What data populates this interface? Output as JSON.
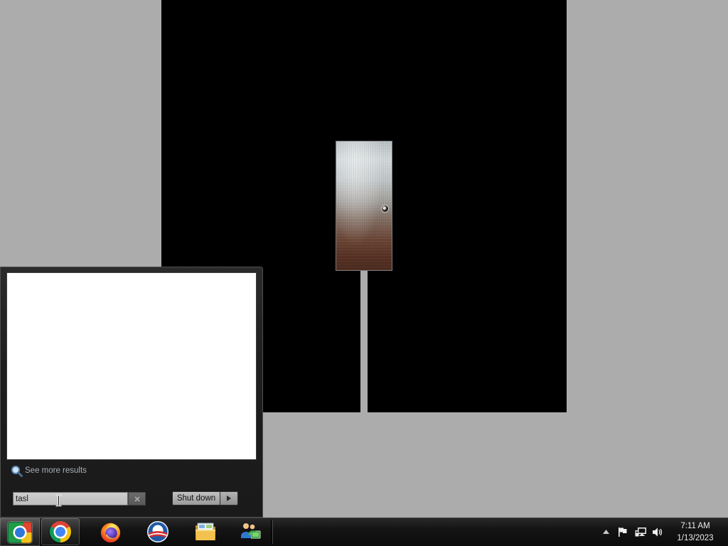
{
  "theme": {
    "desktop_bg": "#acacac",
    "window_bg": "#000000",
    "menu_bg": "#1e1e1e",
    "results_bg": "#ffffff",
    "taskbar_bg": "#0b0b0b"
  },
  "start_menu": {
    "see_more_icon": "search-icon",
    "see_more_results": "See more results",
    "search": {
      "value": "tasl",
      "clear_icon": "clear-search-icon"
    },
    "shutdown": {
      "label": "Shut down",
      "options_icon": "chevron-right-icon"
    }
  },
  "taskbar": {
    "start_icon": "start-orb-icon",
    "pinned": [
      {
        "icon": "chrome-icon",
        "running": true
      },
      {
        "icon": "firefox-icon",
        "running": false
      },
      {
        "icon": "circle-logo-icon",
        "running": false
      },
      {
        "icon": "file-explorer-icon",
        "running": false
      },
      {
        "icon": "people-icon",
        "running": false
      }
    ],
    "tray": {
      "icons": [
        "show-hidden-icons-icon",
        "action-center-flag-icon",
        "network-icon",
        "volume-icon"
      ],
      "time": "7:11 AM",
      "date": "1/13/2023"
    }
  },
  "pointer": {
    "icon": "text-cursor-icon"
  }
}
